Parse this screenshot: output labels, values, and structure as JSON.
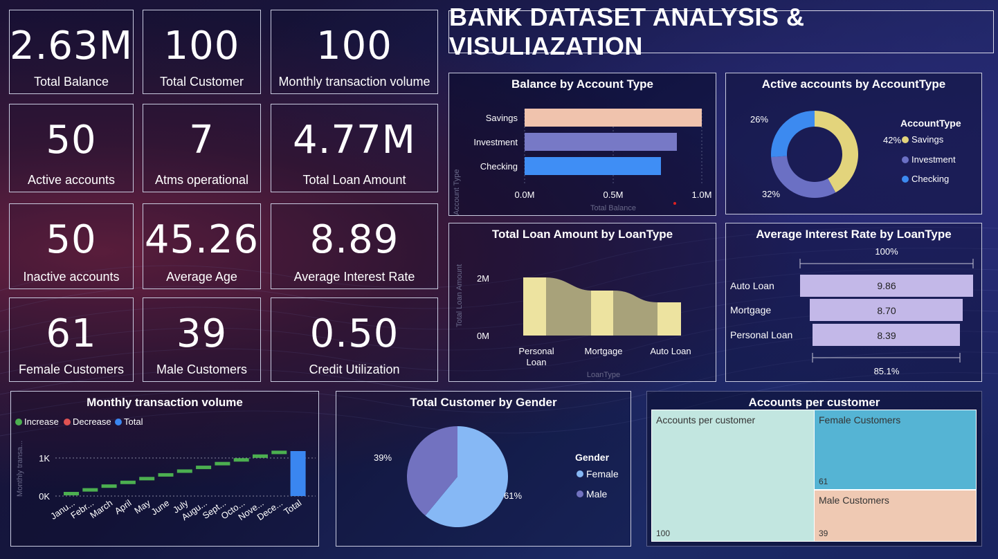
{
  "title": "BANK DATASET ANALYSIS & VISULIAZATION",
  "kpis": [
    {
      "value": "2.63M",
      "label": "Total Balance"
    },
    {
      "value": "100",
      "label": "Total Customer"
    },
    {
      "value": "100",
      "label": "Monthly transaction volume"
    },
    {
      "value": "50",
      "label": "Active accounts"
    },
    {
      "value": "7",
      "label": "Atms operational"
    },
    {
      "value": "4.77M",
      "label": "Total Loan Amount"
    },
    {
      "value": "50",
      "label": "Inactive accounts"
    },
    {
      "value": "45.26",
      "label": "Average Age"
    },
    {
      "value": "8.89",
      "label": "Average Interest Rate"
    },
    {
      "value": "61",
      "label": "Female Customers"
    },
    {
      "value": "39",
      "label": "Male Customers"
    },
    {
      "value": "0.50",
      "label": "Credit Utilization"
    }
  ],
  "balance_chart": {
    "title": "Balance by Account Type",
    "ylabel": "Account Type",
    "xlabel": "Total Balance",
    "categories": [
      "Savings",
      "Investment",
      "Checking"
    ],
    "values": [
      1.0,
      0.86,
      0.77
    ],
    "colors": [
      "#f0c3ad",
      "#7779c6",
      "#3f8ef5"
    ],
    "ticks": [
      "0.0M",
      "0.5M",
      "1.0M"
    ]
  },
  "active_chart": {
    "title": "Active accounts by AccountType",
    "legend_title": "AccountType",
    "labels": [
      "Savings",
      "Investment",
      "Checking"
    ],
    "values": [
      42,
      32,
      26
    ],
    "pct_labels": [
      "42%",
      "32%",
      "26%"
    ],
    "colors": [
      "#e3d47c",
      "#6b70c4",
      "#3c8af0"
    ]
  },
  "loan_chart": {
    "title": "Total Loan Amount by LoanType",
    "ylabel": "Total Loan Amount",
    "xlabel": "LoanType",
    "categories": [
      "Personal Loan",
      "Mortgage",
      "Auto Loan"
    ],
    "values": [
      1.83,
      1.68,
      1.26
    ],
    "ticks": [
      "2M",
      "0M"
    ]
  },
  "interest_chart": {
    "title": "Average Interest Rate by LoanType",
    "categories": [
      "Auto Loan",
      "Mortgage",
      "Personal Loan"
    ],
    "values": [
      9.86,
      8.7,
      8.39
    ],
    "value_labels": [
      "9.86",
      "8.70",
      "8.39"
    ],
    "top_label": "100%",
    "bottom_label": "85.1%"
  },
  "waterfall_chart": {
    "title": "Monthly transaction volume",
    "ylabel": "Monthly transa...",
    "legend": [
      "Increase",
      "Decrease",
      "Total"
    ],
    "legend_colors": [
      "#4caf50",
      "#e05252",
      "#3a86f0"
    ],
    "categories": [
      "Janu...",
      "Febr...",
      "March",
      "April",
      "May",
      "June",
      "July",
      "Augu...",
      "Sept...",
      "Octo...",
      "Nove...",
      "Dece...",
      "Total"
    ],
    "ticks": [
      "1K",
      "0K"
    ]
  },
  "gender_chart": {
    "title": "Total Customer by Gender",
    "legend_title": "Gender",
    "labels": [
      "Female",
      "Male"
    ],
    "values": [
      61,
      39
    ],
    "pct_labels": [
      "61%",
      "39%"
    ],
    "colors": [
      "#86b8f5",
      "#7272c0"
    ]
  },
  "treemap": {
    "title": "Accounts per customer",
    "items": [
      {
        "label": "Accounts per customer",
        "value": "100"
      },
      {
        "label": "Female Customers",
        "value": "61"
      },
      {
        "label": "Male Customers",
        "value": "39"
      }
    ]
  }
}
